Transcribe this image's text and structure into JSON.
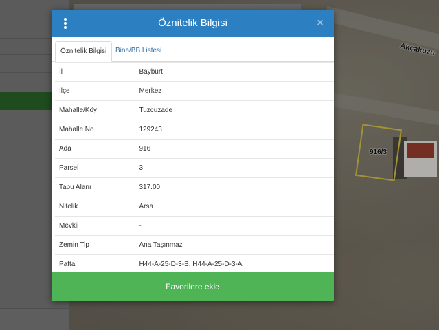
{
  "map": {
    "road_label": "Akçakuzu",
    "parcel_label": "916/3"
  },
  "modal": {
    "title": "Öznitelik Bilgisi",
    "close_symbol": "×",
    "menu_icon": "vertical-ellipsis-icon",
    "tabs": [
      {
        "label": "Öznitelik Bilgisi",
        "active": true
      },
      {
        "label": "Bina/BB Listesi",
        "active": false
      }
    ],
    "rows": [
      {
        "key": "İl",
        "value": "Bayburt"
      },
      {
        "key": "İlçe",
        "value": "Merkez"
      },
      {
        "key": "Mahalle/Köy",
        "value": "Tuzcuzade"
      },
      {
        "key": "Mahalle No",
        "value": "129243"
      },
      {
        "key": "Ada",
        "value": "916"
      },
      {
        "key": "Parsel",
        "value": "3"
      },
      {
        "key": "Tapu Alanı",
        "value": "317.00"
      },
      {
        "key": "Nitelik",
        "value": "Arsa"
      },
      {
        "key": "Mevkii",
        "value": "-"
      },
      {
        "key": "Zemin Tip",
        "value": "Ana Taşınmaz"
      },
      {
        "key": "Pafta",
        "value": "H44-A-25-D-3-B, H44-A-25-D-3-A"
      }
    ],
    "favorite_button": "Favorilere ekle"
  },
  "colors": {
    "header": "#2c7fc1",
    "button": "#4fb456",
    "tab_link": "#2c6da8"
  }
}
